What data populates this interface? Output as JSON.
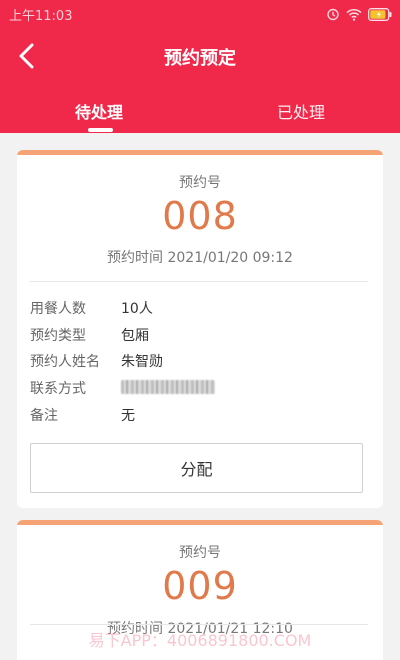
{
  "status_bar": {
    "time": "上午11:03",
    "battery_level": 0.9
  },
  "header": {
    "title": "预约预定",
    "background_color": "#f0284a",
    "back_icon": "chevron-left-icon"
  },
  "tabs": [
    {
      "label": "待处理",
      "active": true
    },
    {
      "label": "已处理",
      "active": false
    }
  ],
  "reservations": [
    {
      "number_label": "预约号",
      "number": "008",
      "time": "预约时间 2021/01/20 09:12",
      "fields": [
        {
          "label": "用餐人数",
          "value": "10人"
        },
        {
          "label": "预约类型",
          "value": "包厢"
        },
        {
          "label": "预约人姓名",
          "value": "朱智勋"
        },
        {
          "label": "联系方式",
          "value": ""
        },
        {
          "label": "备注",
          "value": "无"
        }
      ],
      "action_label": "分配"
    },
    {
      "number_label": "预约号",
      "number": "009",
      "time": "预约时间 2021/01/21 12:10"
    }
  ],
  "colors": {
    "accent": "#f0284a",
    "number": "#e07a4a",
    "card_top_bar": "#f5a374"
  },
  "watermark": "易下APP：4006891800.COM"
}
